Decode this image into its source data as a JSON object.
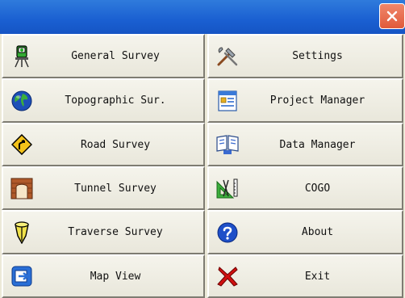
{
  "window": {
    "title": ""
  },
  "menu": {
    "left": [
      {
        "label": "General Survey",
        "icon": "total-station-icon"
      },
      {
        "label": "Topographic Sur.",
        "icon": "globe-icon"
      },
      {
        "label": "Road Survey",
        "icon": "road-sign-icon"
      },
      {
        "label": "Tunnel Survey",
        "icon": "tunnel-icon"
      },
      {
        "label": "Traverse Survey",
        "icon": "traverse-marker-icon"
      },
      {
        "label": "Map View",
        "icon": "map-view-icon"
      }
    ],
    "right": [
      {
        "label": "Settings",
        "icon": "tools-icon"
      },
      {
        "label": "Project Manager",
        "icon": "project-manager-icon"
      },
      {
        "label": "Data Manager",
        "icon": "data-manager-icon"
      },
      {
        "label": "COGO",
        "icon": "cogo-icon"
      },
      {
        "label": "About",
        "icon": "help-icon"
      },
      {
        "label": "Exit",
        "icon": "exit-x-icon"
      }
    ]
  },
  "colors": {
    "titlebar": "#1a5fd1",
    "close": "#e05a3a",
    "button_face": "#ece9d8"
  }
}
